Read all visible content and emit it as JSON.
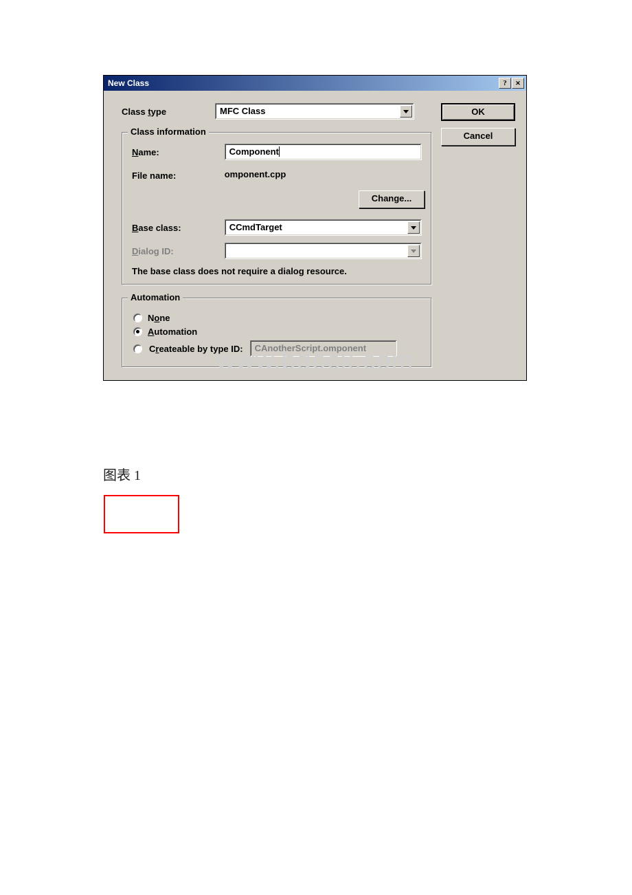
{
  "dialog": {
    "title": "New Class",
    "watermark": "www.bdocx.com",
    "labels": {
      "class_type": "Class type",
      "class_type_ul": "t",
      "name": "Name:",
      "name_ul": "N",
      "file_name": "File name:",
      "base_class": "Base class:",
      "base_class_ul": "B",
      "dialog_id": "Dialog ID:",
      "dialog_id_ul": "D"
    },
    "values": {
      "class_type": "MFC Class",
      "name": "Component",
      "file_name": "omponent.cpp",
      "base_class": "CCmdTarget",
      "dialog_id": ""
    },
    "buttons": {
      "ok": "OK",
      "cancel": "Cancel",
      "change": "Change...",
      "change_ul": "C"
    },
    "groupbox": {
      "class_info": "Class information",
      "automation": "Automation"
    },
    "info_text": "The base class does not require a dialog resource.",
    "automation": {
      "none": "None",
      "none_ul": "o",
      "automation": "Automation",
      "automation_ul": "A",
      "createable": "Createable by type ID:",
      "createable_ul": "r",
      "type_id": "CAnotherScript.omponent",
      "selected": "automation"
    }
  },
  "caption": "图表 1"
}
